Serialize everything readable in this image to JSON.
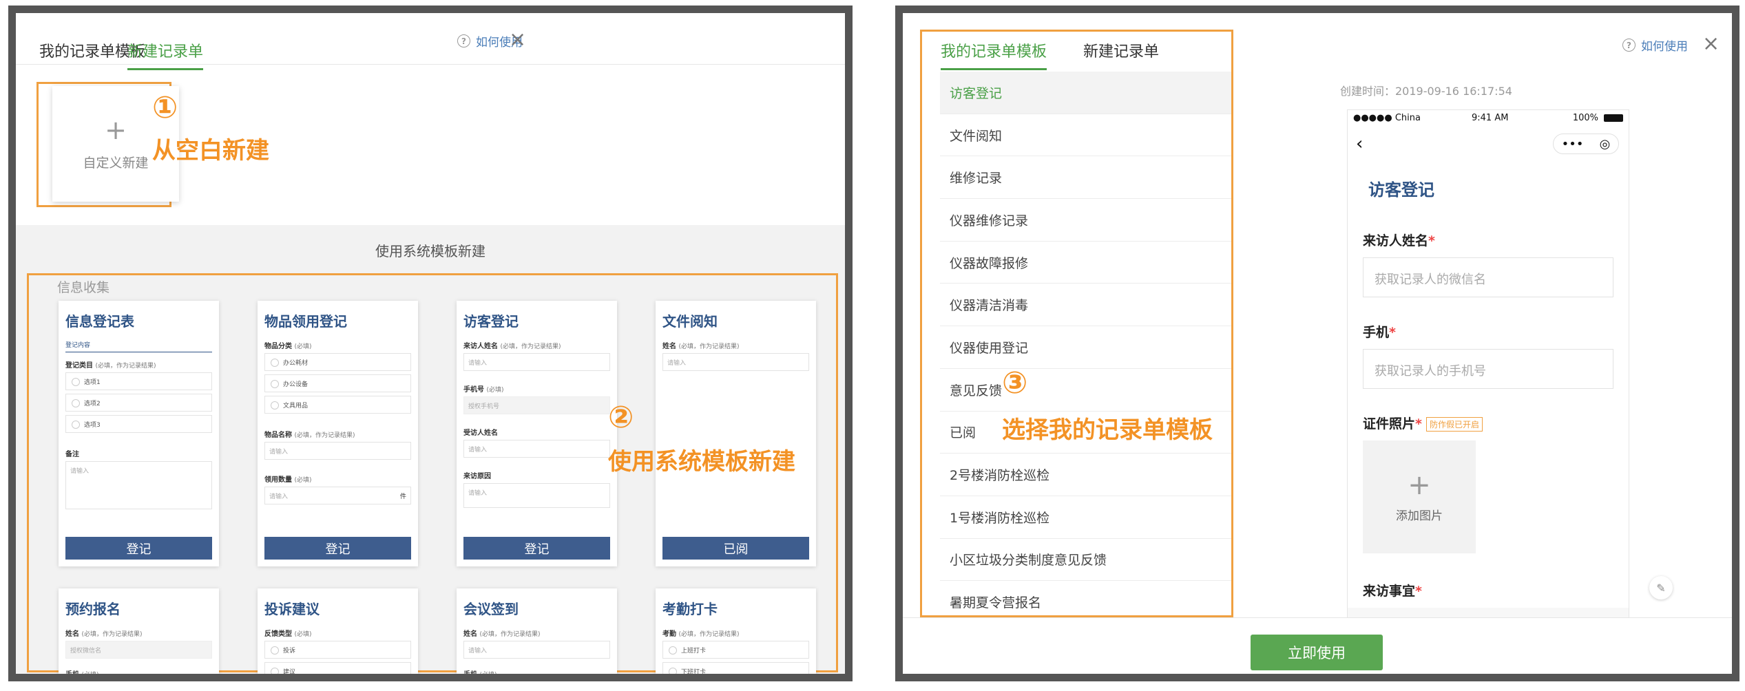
{
  "left": {
    "tabs": [
      "我的记录单模板",
      "新建记录单"
    ],
    "how_to": "如何使用",
    "close": "×",
    "blank_card": {
      "plus": "+",
      "label": "自定义新建"
    },
    "anno1": {
      "num": "①",
      "text": "从空白新建"
    },
    "section_title": "使用系统模板新建",
    "info_label": "信息收集",
    "anno2": {
      "num": "②",
      "text": "使用系统模板新建"
    },
    "cards": [
      {
        "title": "信息登记表",
        "sub": "登记内容",
        "field1": "登记类目",
        "field1_note": "(必填，作为记录结果)",
        "options": [
          "选项1",
          "选项2",
          "选项3"
        ],
        "field2": "备注",
        "ph": "请输入",
        "button": "登记"
      },
      {
        "title": "物品领用登记",
        "field1": "物品分类",
        "field1_note": "(必填)",
        "options": [
          "办公耗材",
          "办公设备",
          "文具用品"
        ],
        "field2": "物品名称",
        "field2_note": "(必填，作为记录结果)",
        "ph": "请输入",
        "field3": "领用数量",
        "field3_note": "(必填)",
        "unit": "件",
        "button": "登记"
      },
      {
        "title": "访客登记",
        "field1": "来访人姓名",
        "field1_note": "(必填，作为记录结果)",
        "ph": "请输入",
        "field2": "手机号",
        "field2_note": "(必填)",
        "ph2": "授权手机号",
        "field3": "受访人姓名",
        "field4": "来访原因",
        "button": "登记"
      },
      {
        "title": "文件阅知",
        "field1": "姓名",
        "field1_note": "(必填，作为记录结果)",
        "ph": "请输入",
        "button": "已阅"
      },
      {
        "title": "预约报名",
        "field1": "姓名",
        "field1_note": "(必填，作为记录结果)",
        "ph": "授权微信名",
        "field2": "手机",
        "field2_note": "(必填)"
      },
      {
        "title": "投诉建议",
        "field1": "反馈类型",
        "field1_note": "(必填)",
        "options": [
          "投诉",
          "建议"
        ]
      },
      {
        "title": "会议签到",
        "field1": "姓名",
        "field1_note": "(必填，作为记录结果)",
        "ph": "请输入",
        "field2": "手机",
        "field2_note": "(必填)"
      },
      {
        "title": "考勤打卡",
        "field1": "考勤",
        "field1_note": "(必填，作为记录结果)",
        "options": [
          "上班打卡",
          "下班打卡"
        ]
      }
    ]
  },
  "right": {
    "tabs": [
      "我的记录单模板",
      "新建记录单"
    ],
    "how_to": "如何使用",
    "close": "×",
    "templates": [
      "访客登记",
      "文件阅知",
      "维修记录",
      "仪器维修记录",
      "仪器故障报修",
      "仪器清洁消毒",
      "仪器使用登记",
      "意见反馈",
      "已阅",
      "2号楼消防栓巡检",
      "1号楼消防栓巡检",
      "小区垃圾分类制度意见反馈",
      "暑期夏令营报名"
    ],
    "anno3": {
      "num": "③",
      "text": "选择我的记录单模板"
    },
    "created_time": "创建时间：2019-09-16 16:17:54",
    "phone": {
      "carrier": "●●●●● China",
      "time": "9:41 AM",
      "battery": "100%",
      "back": "‹",
      "capsule_dots": "•••",
      "capsule_target": "◎",
      "title": "访客登记",
      "fields": [
        {
          "label": "来访人姓名",
          "req": "*",
          "placeholder": "获取记录人的微信名"
        },
        {
          "label": "手机",
          "req": "*",
          "placeholder": "获取记录人的手机号"
        }
      ],
      "photo_label": "证件照片",
      "photo_req": "*",
      "photo_badge": "防作假已开启",
      "add_plus": "+",
      "add_image": "添加图片",
      "reason_label": "来访事宜",
      "reason_req": "*"
    },
    "edit_icon": "✎",
    "use_button": "立即使用"
  }
}
